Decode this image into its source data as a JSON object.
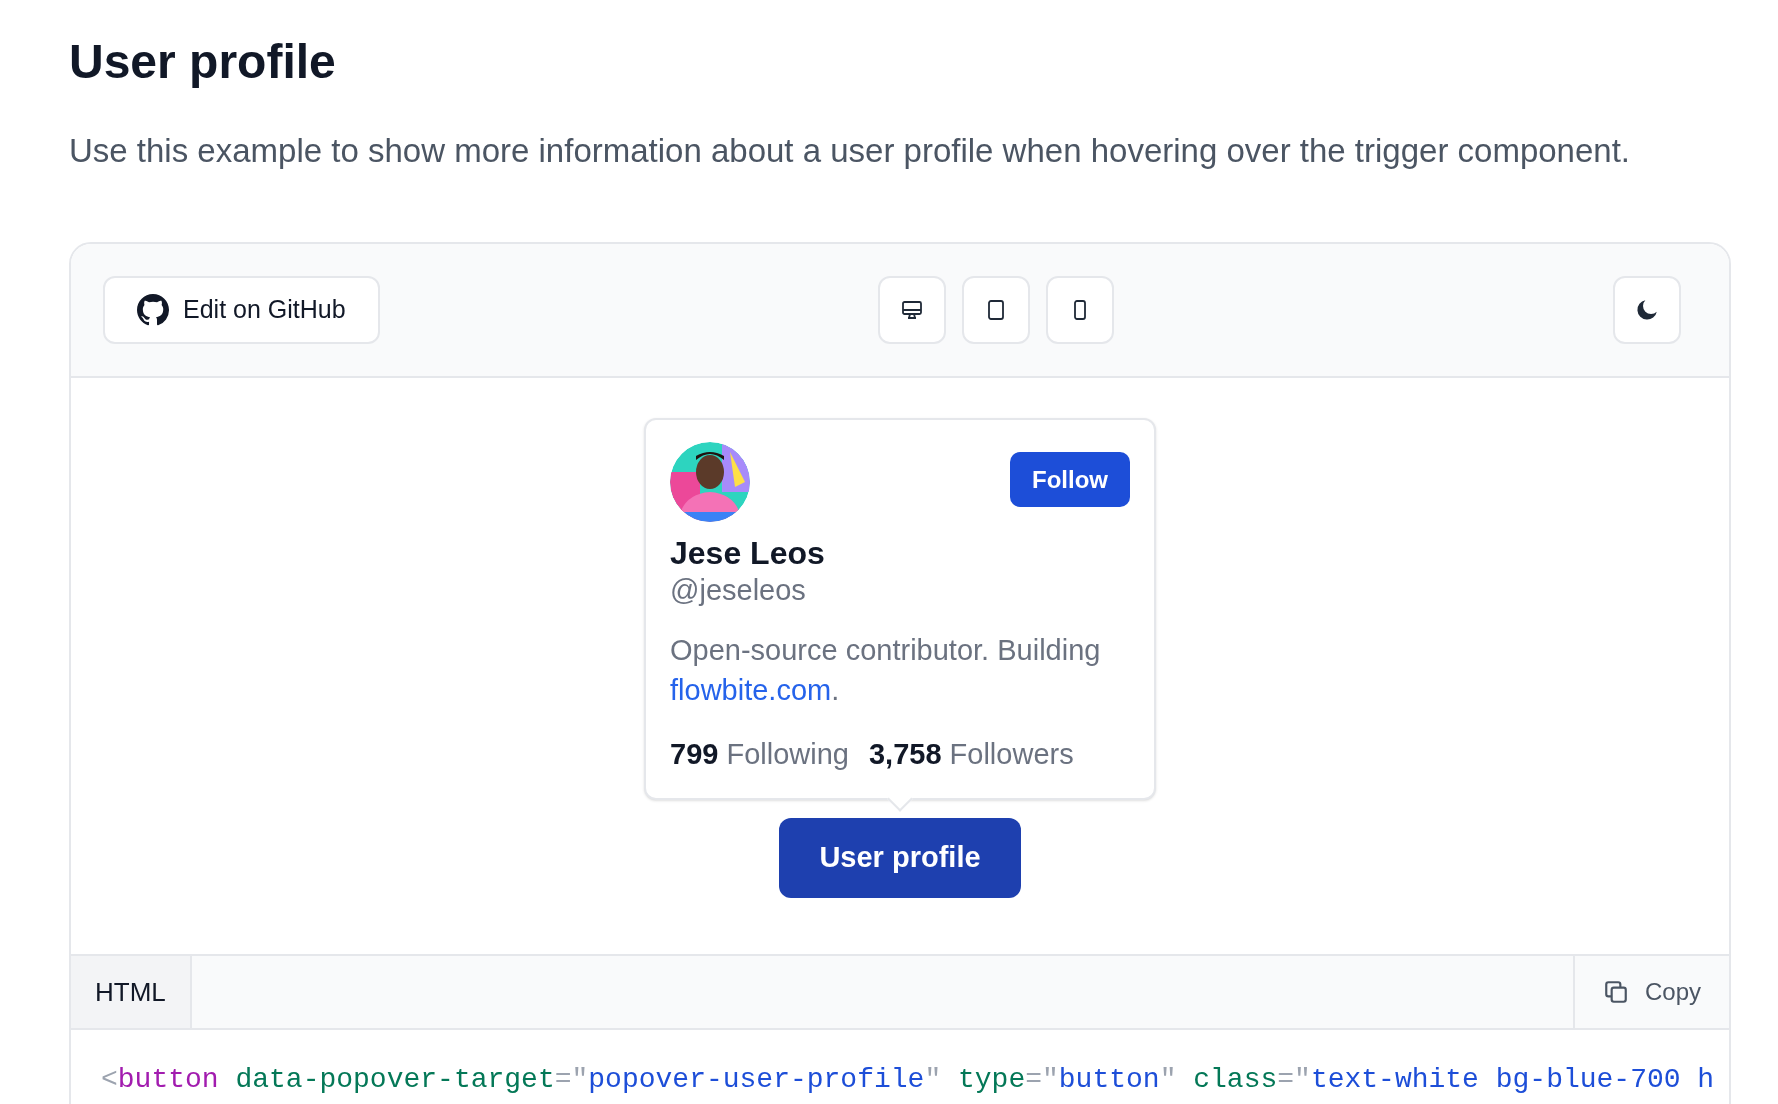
{
  "heading": "User profile",
  "description": "Use this example to show more information about a user profile when hovering over the trigger component.",
  "toolbar": {
    "edit_button": "Edit on GitHub",
    "device_buttons": [
      {
        "kind": "desktop"
      },
      {
        "kind": "tablet"
      },
      {
        "kind": "mobile"
      }
    ],
    "theme_button": {
      "kind": "moon"
    }
  },
  "popover": {
    "follow_button": "Follow",
    "name": "Jese Leos",
    "handle": "@jeseleos",
    "bio": "Open-source contributor. Building ",
    "bio_link": "flowbite.com",
    "bio_end": ".",
    "stats": [
      "**799** Following",
      "**3,758** Followers"
    ]
  },
  "trigger_button": "User profile",
  "code_tabs": [
    {
      "label": "HTML",
      "selected": true
    }
  ],
  "copy_button": "Copy",
  "code": [
    {
      "kind": "punct",
      "text": "<"
    },
    {
      "kind": "tag",
      "text": "button"
    },
    {
      "kind": "attr",
      "text": " data-popover-target"
    },
    {
      "kind": "punct",
      "text": "=\""
    },
    {
      "kind": "string",
      "text": "popover-user-profile"
    },
    {
      "kind": "punct",
      "text": "\""
    },
    {
      "kind": "attr",
      "text": " type"
    },
    {
      "kind": "punct",
      "text": "=\""
    },
    {
      "kind": "string",
      "text": "button"
    },
    {
      "kind": "punct",
      "text": "\""
    },
    {
      "kind": "attr",
      "text": " class"
    },
    {
      "kind": "punct",
      "text": "=\""
    },
    {
      "kind": "string",
      "text": "text-white bg-blue-700 h"
    }
  ]
}
